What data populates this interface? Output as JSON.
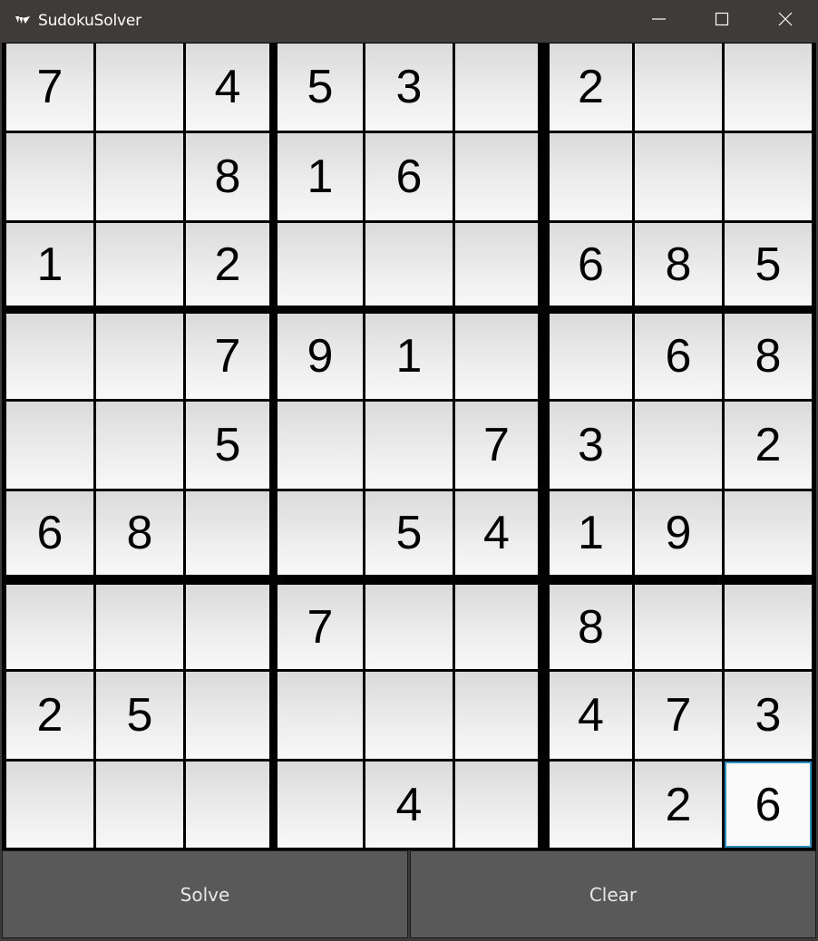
{
  "window": {
    "title": "SudokuSolver",
    "app_icon": "kivy-logo-icon",
    "controls": [
      "minimize-icon",
      "maximize-icon",
      "close-icon"
    ]
  },
  "board": {
    "rows": [
      [
        "7",
        "",
        "4",
        "5",
        "3",
        "",
        "2",
        "",
        ""
      ],
      [
        "",
        "",
        "8",
        "1",
        "6",
        "",
        "",
        "",
        ""
      ],
      [
        "1",
        "",
        "2",
        "",
        "",
        "",
        "6",
        "8",
        "5"
      ],
      [
        "",
        "",
        "7",
        "9",
        "1",
        "",
        "",
        "6",
        "8"
      ],
      [
        "",
        "",
        "5",
        "",
        "",
        "7",
        "3",
        "",
        "2"
      ],
      [
        "6",
        "8",
        "",
        "",
        "5",
        "4",
        "1",
        "9",
        ""
      ],
      [
        "",
        "",
        "",
        "7",
        "",
        "",
        "8",
        "",
        ""
      ],
      [
        "2",
        "5",
        "",
        "",
        "",
        "",
        "4",
        "7",
        "3"
      ],
      [
        "",
        "",
        "",
        "",
        "4",
        "",
        "",
        "2",
        "6"
      ]
    ],
    "focused_cell": {
      "row": 8,
      "col": 8
    },
    "focus_color": "#2f8ec2"
  },
  "buttons": {
    "solve_label": "Solve",
    "clear_label": "Clear"
  }
}
